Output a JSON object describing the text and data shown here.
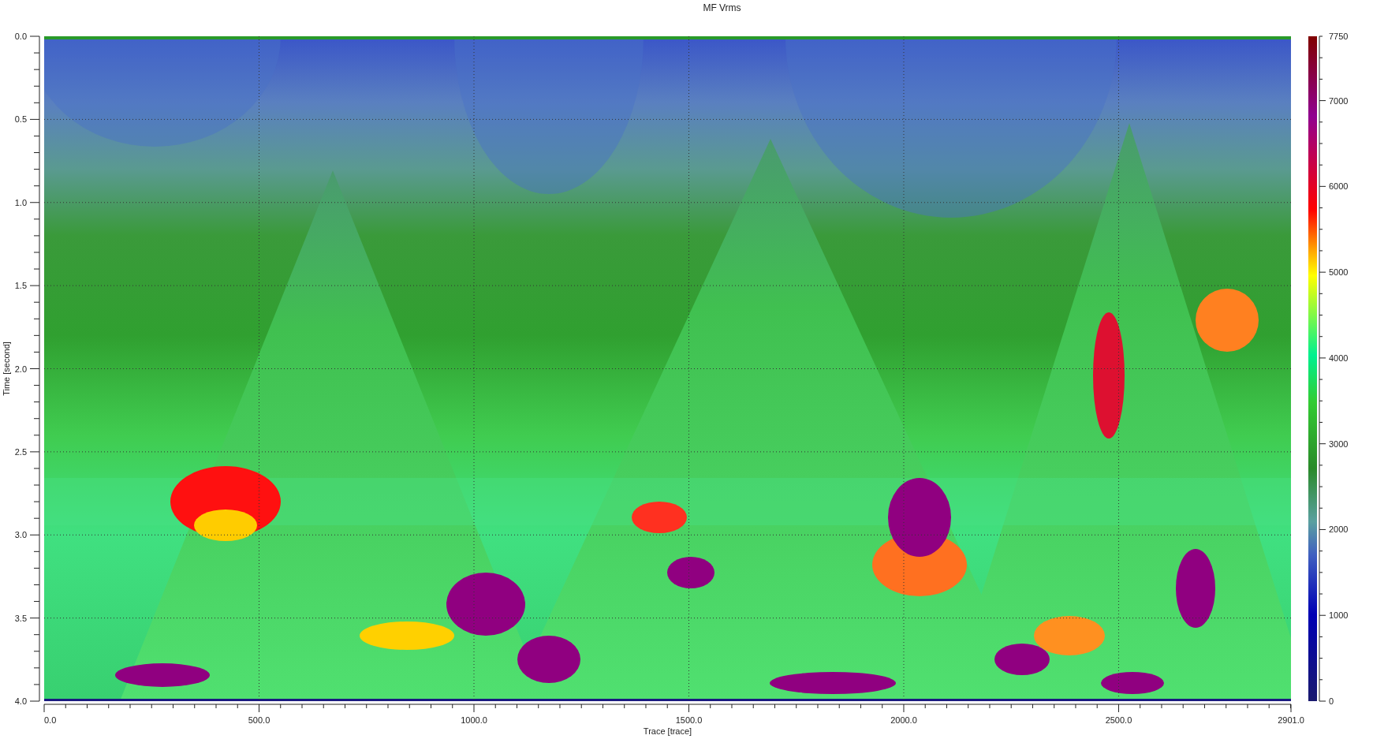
{
  "title": "MF Vrms",
  "y_axis": {
    "label": "Time [second]",
    "ticks": [
      "0.0",
      "0.5",
      "1.0",
      "1.5",
      "2.0",
      "2.5",
      "3.0",
      "3.5",
      "4.0"
    ]
  },
  "x_axis": {
    "label": "Trace [trace]",
    "ticks": [
      "0.0",
      "500.0",
      "1000.0",
      "1500.0",
      "2000.0",
      "2500.0",
      "2901.0"
    ]
  },
  "color_scale": {
    "ticks": [
      "7750",
      "7000",
      "6000",
      "5000",
      "4000",
      "3000",
      "2000",
      "1000",
      "0"
    ]
  }
}
